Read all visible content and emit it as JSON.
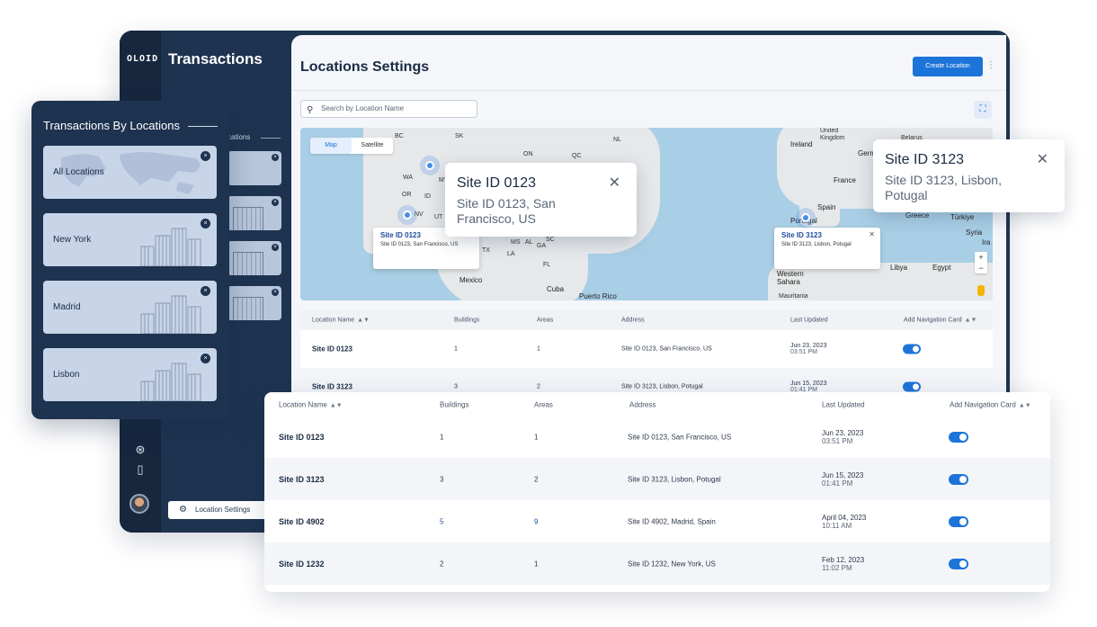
{
  "app": {
    "logo": "OLOID",
    "sidebar_title": "Transactions",
    "sidebar_sub": "cations",
    "location_settings_label": "Location Settings",
    "rail_icons": [
      "help-icon",
      "document-icon"
    ]
  },
  "main": {
    "title": "Locations Settings",
    "create_button": "Create Location",
    "search_placeholder": "Search by Location Name"
  },
  "map": {
    "tabs": [
      "Map",
      "Satellite"
    ],
    "labels": [
      "BC",
      "SK",
      "ON",
      "QC",
      "NL",
      "WA",
      "MT",
      "OR",
      "ID",
      "NV",
      "UT",
      "TX",
      "MS",
      "AL",
      "GA",
      "SC",
      "LA",
      "FL",
      "Mexico",
      "Cuba",
      "Puerto Rico",
      "Ireland",
      "United Kingdom",
      "Belarus",
      "Germ",
      "France",
      "Spain",
      "Portugal",
      "Greece",
      "Türkiye",
      "Syria",
      "Ira",
      "Libya",
      "Egypt",
      "Western Sahara",
      "Mauritania",
      "Iuc"
    ],
    "popups": [
      {
        "title": "Site ID 0123",
        "desc": "Site ID 0123, San Francisco, US"
      },
      {
        "title": "Site ID 3123",
        "desc": "Site ID 3123, Lisbon, Potugal"
      }
    ]
  },
  "big_popups": [
    {
      "title": "Site ID 0123",
      "desc_line1": "Site ID 0123, San",
      "desc_line2": "Francisco, US"
    },
    {
      "title": "Site ID 3123",
      "desc_line1": "Site ID 3123, Lisbon,",
      "desc_line2": "Potugal"
    }
  ],
  "table": {
    "headers": [
      "Location Name",
      "Buildings",
      "Areas",
      "Address",
      "Last Updated",
      "Add Navigation Card"
    ],
    "rows": [
      {
        "name": "Site ID 0123",
        "buildings": "1",
        "areas": "1",
        "address": "Site ID 0123, San Francisco, US",
        "date": "Jun 23, 2023",
        "time": "03:51 PM"
      },
      {
        "name": "Site ID 3123",
        "buildings": "3",
        "areas": "2",
        "address": "Site ID 3123, Lisbon, Potugal",
        "date": "Jun 15, 2023",
        "time": "01:41 PM"
      },
      {
        "name": "Site ID 4902",
        "buildings": "5",
        "areas": "9",
        "address": "Site ID 4902, Madrid, Spain",
        "date": "April 04, 2023",
        "time": "10:11 AM"
      },
      {
        "name": "Site ID 1232",
        "buildings": "2",
        "areas": "1",
        "address": "Site ID 1232, New York, US",
        "date": "Feb 12, 2023",
        "time": "11:02 PM"
      }
    ]
  },
  "left_panel": {
    "title": "Transactions By Locations",
    "cards": [
      "All Locations",
      "New York",
      "Madrid",
      "Lisbon"
    ]
  },
  "colors": {
    "navy": "#1e3350",
    "accent": "#1d74d8",
    "map_water": "#a9cfe6"
  }
}
